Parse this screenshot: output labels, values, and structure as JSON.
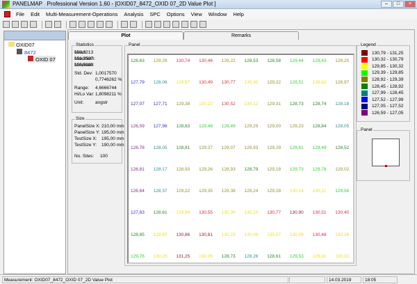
{
  "window": {
    "app": "PANELMAP",
    "title": "PANELMAP   Professional Version 1.60 - [OXID07_8472_OXID 07_2D Value Plot ]"
  },
  "menu": [
    "File",
    "Edit",
    "Multi-Measurement-Operations",
    "Analysis",
    "SPC",
    "Options",
    "View",
    "Window",
    "Help"
  ],
  "tree": {
    "root": "OXID07",
    "child": "8472",
    "leaf": "OXID 07"
  },
  "tabs": {
    "plot": "Plot",
    "remarks": "Remarks"
  },
  "statistics": {
    "title": "Statistics",
    "rows": [
      {
        "label": "Mean:",
        "value": "129,3213"
      },
      {
        "label": "Maximum:",
        "value": "131,2597"
      },
      {
        "label": "Minimum:",
        "value": "126,5930"
      },
      {
        "label": "Std. Dev:",
        "value": "1,0017570"
      },
      {
        "label": "",
        "value": "0,7746262 %"
      },
      {
        "label": "Range:",
        "value": "4,6666744"
      },
      {
        "label": "Hi/Lo Var:",
        "value": "1,8098211 %"
      },
      {
        "label": "Unit:",
        "value": "angstr"
      }
    ]
  },
  "size": {
    "title": "Size",
    "rows": [
      {
        "label": "PanelSize X:",
        "value": "210,00 mm"
      },
      {
        "label": "PanelSize Y:",
        "value": "195,00 mm"
      },
      {
        "label": "TestSize X:",
        "value": "195,00 mm"
      },
      {
        "label": "TestSize Y:",
        "value": "190,00 mm"
      },
      {
        "label": "No. Sites:",
        "value": "100"
      }
    ]
  },
  "panel": {
    "title": "Panel",
    "values": [
      [
        "128,63",
        "129,28",
        "130,74",
        "130,46",
        "129,22",
        "128,53",
        "128,58",
        "129,44",
        "129,43",
        "129,25"
      ],
      [
        "127,79",
        "128,06",
        "129,97",
        "130,49",
        "130,77",
        "130,30",
        "129,22",
        "129,51",
        "129,92",
        "128,97"
      ],
      [
        "127,07",
        "127,71",
        "129,38",
        "130,22",
        "130,52",
        "130,12",
        "129,31",
        "128,73",
        "128,74",
        "128,18"
      ],
      [
        "126,59",
        "127,96",
        "128,83",
        "129,49",
        "129,49",
        "129,29",
        "129,00",
        "129,23",
        "128,84",
        "128,05"
      ],
      [
        "126,78",
        "128,05",
        "128,81",
        "129,37",
        "129,07",
        "128,93",
        "129,29",
        "129,61",
        "129,49",
        "128,52"
      ],
      [
        "126,81",
        "128,17",
        "128,93",
        "129,26",
        "128,93",
        "128,79",
        "129,18",
        "129,73",
        "129,78",
        "129,02"
      ],
      [
        "126,64",
        "128,37",
        "129,22",
        "129,35",
        "129,38",
        "129,24",
        "129,28",
        "130,14",
        "130,11",
        "129,56"
      ],
      [
        "127,63",
        "128,61",
        "129,99",
        "130,55",
        "130,30",
        "130,24",
        "130,77",
        "130,90",
        "130,51",
        "130,40"
      ],
      [
        "128,85",
        "129,97",
        "130,86",
        "130,81",
        "130,23",
        "130,06",
        "130,27",
        "130,09",
        "130,48",
        "130,28"
      ],
      [
        "129,76",
        "130,29",
        "131,25",
        "130,06",
        "128,73",
        "128,26",
        "128,61",
        "129,53",
        "129,91",
        "130,31"
      ]
    ]
  },
  "legend": {
    "title": "Legend",
    "items": [
      {
        "range": "130,79 - 131,25",
        "color": "#800000",
        "text": "#8b2030"
      },
      {
        "range": "130,32 - 130,79",
        "color": "#ff0000",
        "text": "#d03040"
      },
      {
        "range": "129,85 - 130,32",
        "color": "#ffff00",
        "text": "#e8e020"
      },
      {
        "range": "129,39 - 129,85",
        "color": "#00ff00",
        "text": "#30d030"
      },
      {
        "range": "128,92 - 129,39",
        "color": "#808000",
        "text": "#909030"
      },
      {
        "range": "128,45 - 128,92",
        "color": "#008000",
        "text": "#308030"
      },
      {
        "range": "127,99 - 128,45",
        "color": "#008080",
        "text": "#309090"
      },
      {
        "range": "127,52 - 127,99",
        "color": "#0000ff",
        "text": "#3030d0"
      },
      {
        "range": "127,05 - 127,52",
        "color": "#000080",
        "text": "#303080"
      },
      {
        "range": "126,59 - 127,05",
        "color": "#800080",
        "text": "#803080"
      }
    ]
  },
  "mini_panel": {
    "title": "Panel"
  },
  "status": {
    "measurement": "Measurement: OXID07_8472_OXID 07_2D Value Plot",
    "date": "14.03.2019",
    "time": "18:05"
  }
}
